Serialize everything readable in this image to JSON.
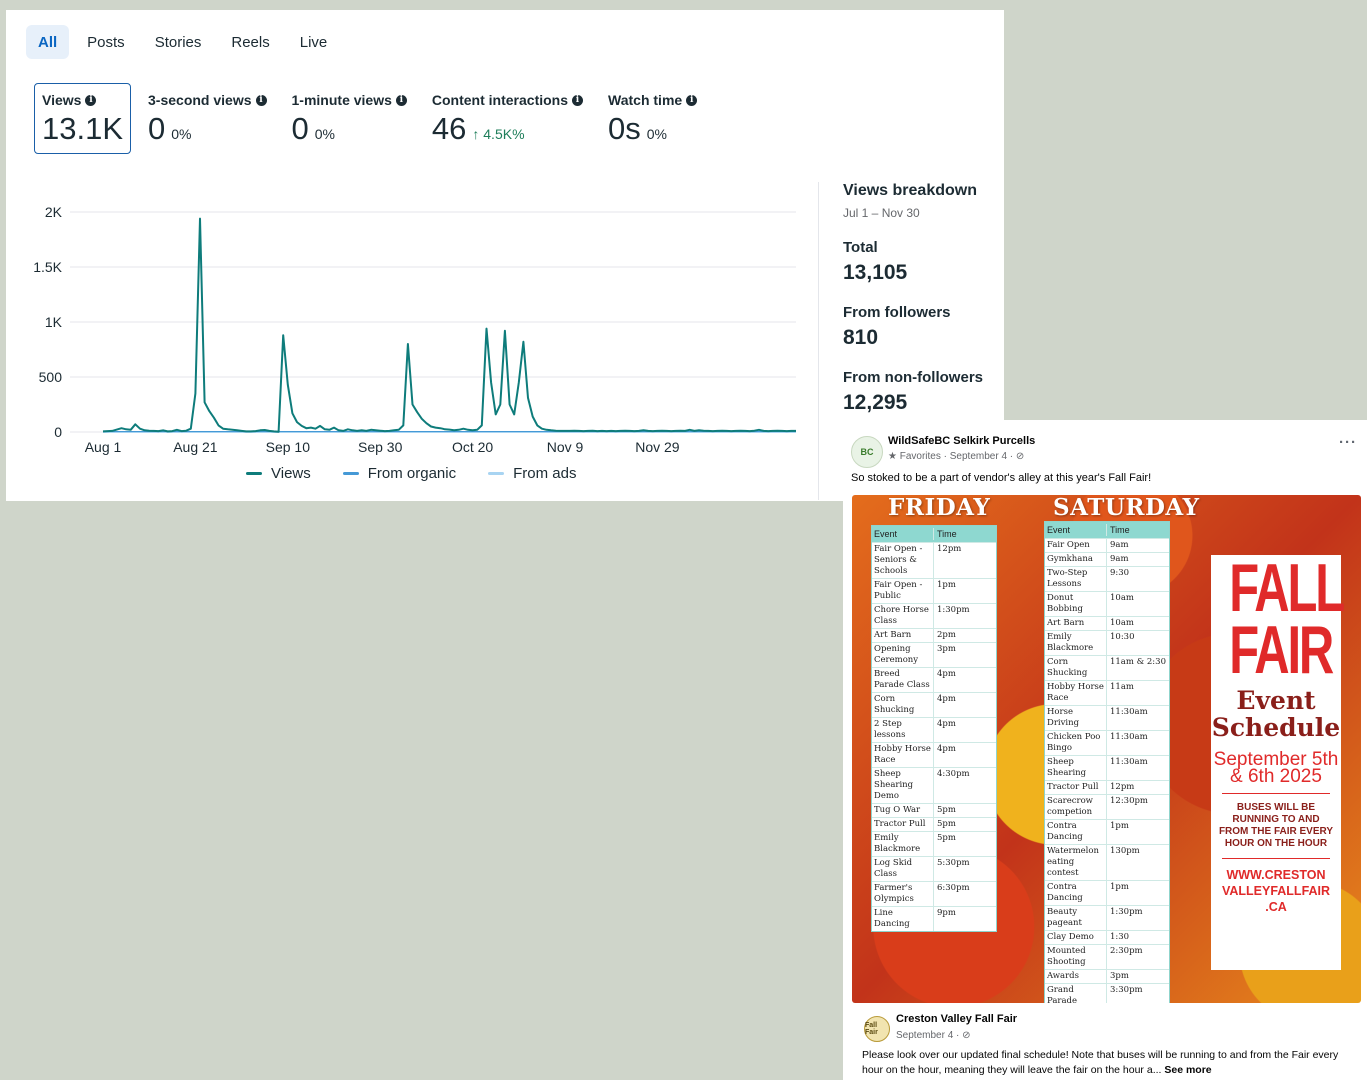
{
  "insights": {
    "tabs": [
      "All",
      "Posts",
      "Stories",
      "Reels",
      "Live"
    ],
    "metrics": [
      {
        "label": "Views",
        "value": "13.1K",
        "change": "",
        "up": false
      },
      {
        "label": "3-second views",
        "value": "0",
        "change": "0%",
        "up": false
      },
      {
        "label": "1-minute views",
        "value": "0",
        "change": "0%",
        "up": false
      },
      {
        "label": "Content interactions",
        "value": "46",
        "change": "↑ 4.5K%",
        "up": true
      },
      {
        "label": "Watch time",
        "value": "0s",
        "change": "0%",
        "up": false
      }
    ],
    "info_icon": "info-icon",
    "accent_color": "#0a66c2"
  },
  "chart_data": {
    "type": "line",
    "x_tick_labels": [
      "Aug 1",
      "Aug 21",
      "Sep 10",
      "Sep 30",
      "Oct 20",
      "Nov 9",
      "Nov 29"
    ],
    "y_tick_labels": [
      "0",
      "500",
      "1K",
      "1.5K",
      "2K"
    ],
    "ylim": [
      0,
      2000
    ],
    "grid": true,
    "legend_position": "bottom",
    "x_days_from_aug1": [
      0,
      2,
      4,
      5,
      6,
      7,
      8,
      9,
      10,
      11,
      12,
      13,
      14,
      15,
      16,
      17,
      18,
      19,
      20,
      21,
      22,
      23,
      24,
      25,
      26,
      27,
      28,
      29,
      30,
      31,
      32,
      33,
      34,
      35,
      36,
      37,
      38,
      39,
      40,
      41,
      42,
      43,
      44,
      45,
      46,
      47,
      48,
      49,
      50,
      51,
      52,
      53,
      54,
      55,
      56,
      57,
      58,
      59,
      60,
      61,
      62,
      63,
      64,
      65,
      66,
      67,
      68,
      69,
      70,
      71,
      72,
      73,
      73.5,
      74,
      75,
      76,
      77,
      78,
      79,
      80,
      81,
      82,
      83,
      84,
      85,
      86,
      87,
      88,
      89,
      90,
      91,
      92,
      93,
      94,
      95,
      96,
      97,
      98,
      99,
      100,
      101,
      102,
      103,
      104,
      105,
      106,
      107,
      108,
      109,
      110,
      111,
      112,
      113,
      114,
      115,
      116,
      117,
      118,
      119,
      120,
      121,
      122,
      123,
      124,
      125,
      126,
      127,
      128,
      129,
      130,
      131,
      132,
      133,
      134,
      135,
      136,
      137,
      138,
      139,
      140,
      141,
      142,
      143,
      144,
      145,
      146,
      147,
      148,
      149,
      150
    ],
    "series": [
      {
        "name": "Views",
        "color": "#0e7c7b",
        "values": [
          5,
          10,
          35,
          25,
          20,
          70,
          30,
          15,
          12,
          10,
          8,
          15,
          5,
          8,
          20,
          8,
          12,
          30,
          350,
          1940,
          270,
          190,
          130,
          60,
          30,
          25,
          20,
          15,
          10,
          5,
          5,
          8,
          15,
          18,
          10,
          5,
          3,
          880,
          430,
          170,
          90,
          55,
          35,
          40,
          30,
          55,
          25,
          20,
          40,
          15,
          10,
          25,
          15,
          10,
          15,
          10,
          20,
          15,
          12,
          8,
          10,
          15,
          20,
          60,
          800,
          250,
          180,
          120,
          80,
          50,
          40,
          35,
          30,
          25,
          22,
          15,
          20,
          30,
          20,
          15,
          20,
          60,
          940,
          450,
          160,
          250,
          920,
          250,
          160,
          450,
          820,
          310,
          140,
          60,
          30,
          20,
          15,
          12,
          10,
          10,
          10,
          12,
          10,
          8,
          10,
          12,
          8,
          10,
          8,
          10,
          8,
          10,
          12,
          10,
          8,
          10,
          15,
          10,
          8,
          10,
          12,
          10,
          8,
          10,
          12,
          10,
          20,
          10,
          15,
          12,
          10,
          8,
          10,
          12,
          10,
          8,
          10,
          12,
          10,
          8,
          12,
          20,
          10,
          8,
          10,
          12,
          10,
          8,
          10,
          10
        ]
      },
      {
        "name": "From organic",
        "color": "#4599d6",
        "values": []
      },
      {
        "name": "From ads",
        "color": "#a8d4f2",
        "values": []
      }
    ]
  },
  "breakdown": {
    "title": "Views breakdown",
    "date_range": "Jul 1 – Nov 30",
    "total_label": "Total",
    "total": "13,105",
    "followers_label": "From followers",
    "followers": "810",
    "non_followers_label": "From non-followers",
    "non_followers": "12,295"
  },
  "post": {
    "page_name": "WildSafeBC Selkirk Purcells",
    "avatar_text": "BC",
    "meta": "★ Favorites · September 4 · ⊘",
    "more": "···",
    "text": "So stoked to be a part of vendor's alley at this year's Fall Fair!",
    "shared_name": "Creston Valley Fall Fair",
    "shared_avatar_text": "Fall Fair",
    "shared_meta": "September 4 · ⊘",
    "shared_text": "Please look over our updated final schedule! Note that buses will be running to and from the Fair every hour on the hour, meaning they will leave the fair on the hour a...",
    "see_more": "See more"
  },
  "poster": {
    "friday_title": "FRIDAY",
    "saturday_title": "SATURDAY",
    "col_event": "Event",
    "col_time": "Time",
    "friday": [
      [
        "Fair Open - Seniors & Schools",
        "12pm"
      ],
      [
        "Fair Open - Public",
        "1pm"
      ],
      [
        "Chore Horse Class",
        "1:30pm"
      ],
      [
        "Art Barn",
        "2pm"
      ],
      [
        "Opening Ceremony",
        "3pm"
      ],
      [
        "Breed Parade Class",
        "4pm"
      ],
      [
        "Corn Shucking",
        "4pm"
      ],
      [
        "2 Step lessons",
        "4pm"
      ],
      [
        "Hobby Horse Race",
        "4pm"
      ],
      [
        "Sheep Shearing Demo",
        "4:30pm"
      ],
      [
        "Tug O War",
        "5pm"
      ],
      [
        "Tractor Pull",
        "5pm"
      ],
      [
        "Emily Blackmore",
        "5pm"
      ],
      [
        "Log Skid Class",
        "5:30pm"
      ],
      [
        "Farmer's Olympics",
        "6:30pm"
      ],
      [
        "Line Dancing",
        "9pm"
      ]
    ],
    "saturday": [
      [
        "Fair Open",
        "9am"
      ],
      [
        "Gymkhana",
        "9am"
      ],
      [
        "Two-Step Lessons",
        "9:30"
      ],
      [
        "Donut Bobbing",
        "10am"
      ],
      [
        "Art Barn",
        "10am"
      ],
      [
        "Emily Blackmore",
        "10:30"
      ],
      [
        "Corn Shucking",
        "11am & 2:30"
      ],
      [
        "Hobby Horse Race",
        "11am"
      ],
      [
        "Horse Driving",
        "11:30am"
      ],
      [
        "Chicken Poo Bingo",
        "11:30am"
      ],
      [
        "Sheep Shearing",
        "11:30am"
      ],
      [
        "Tractor Pull",
        "12pm"
      ],
      [
        "Scarecrow competion",
        "12:30pm"
      ],
      [
        "Contra Dancing",
        "1pm"
      ],
      [
        "Watermelon eating contest",
        "130pm"
      ],
      [
        "Contra Dancing",
        "1pm"
      ],
      [
        "Beauty pageant",
        "1:30pm"
      ],
      [
        "Clay Demo",
        "1:30"
      ],
      [
        "Mounted Shooting",
        "2:30pm"
      ],
      [
        "Awards",
        "3pm"
      ],
      [
        "Grand Parade",
        "3:30pm"
      ]
    ],
    "fall": "FALL",
    "fair": "FAIR",
    "event": "Event",
    "schedule": "Schedule",
    "dates": "September 5th & 6th 2025",
    "bus_note": "BUSES WILL BE RUNNING TO AND FROM THE FAIR EVERY HOUR ON THE HOUR",
    "website": "WWW.CRESTON VALLEYFALLFAIR .CA"
  }
}
